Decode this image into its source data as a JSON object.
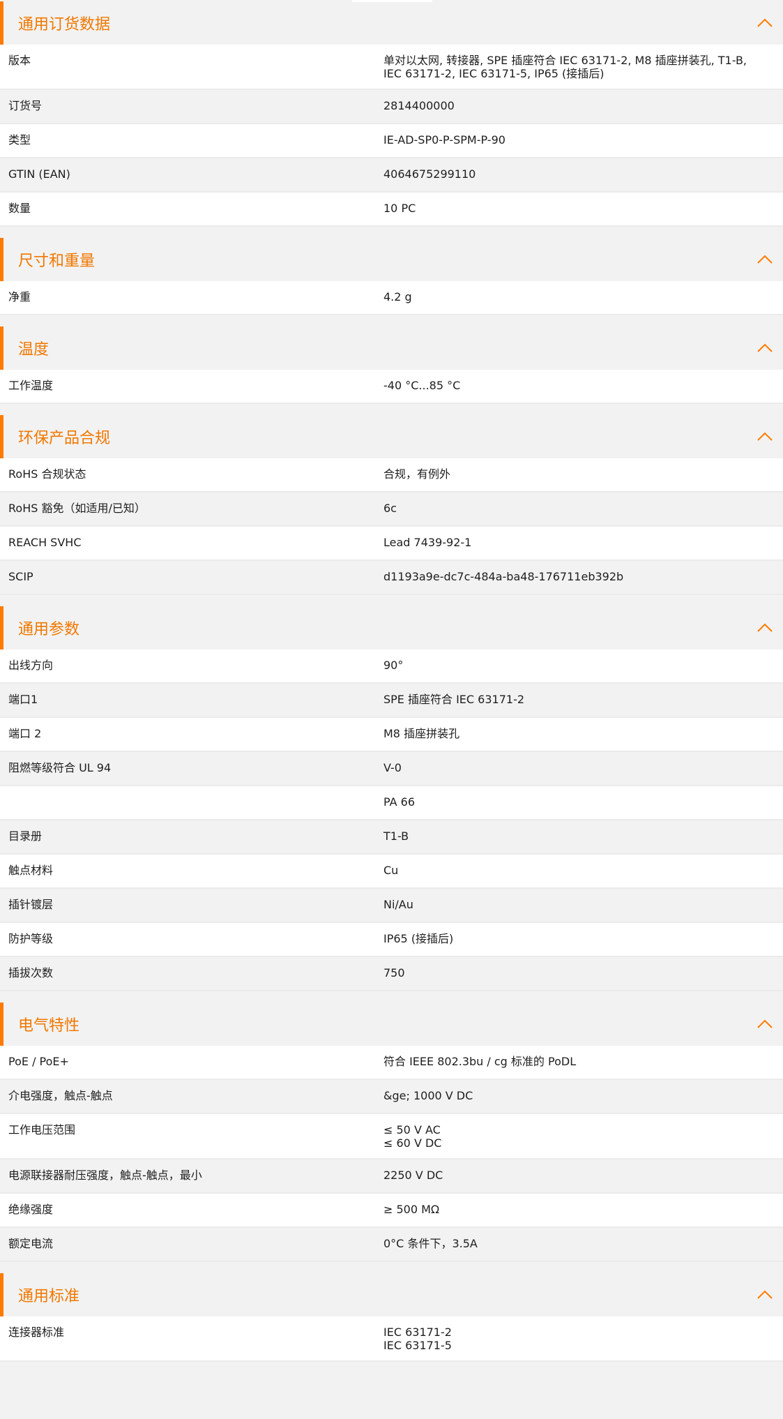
{
  "accent_color": "#ff7b00",
  "sections": [
    {
      "title": "通用订货数据",
      "collapse_icon": "chevron-up-icon",
      "rows": [
        {
          "label": "版本",
          "value": [
            "单对以太网, 转接器, SPE 插座符合 IEC 63171-2, M8 插座拼装孔, T1-B,",
            "IEC 63171-2, IEC 63171-5, IP65 (接插后)"
          ]
        },
        {
          "label": "订货号",
          "value": [
            "2814400000"
          ]
        },
        {
          "label": "类型",
          "value": [
            "IE-AD-SP0-P-SPM-P-90"
          ]
        },
        {
          "label": "GTIN (EAN)",
          "value": [
            "4064675299110"
          ]
        },
        {
          "label": "数量",
          "value": [
            "10  PC"
          ]
        }
      ]
    },
    {
      "title": "尺寸和重量",
      "collapse_icon": "chevron-up-icon",
      "rows": [
        {
          "label": "净重",
          "value": [
            "4.2  g"
          ]
        }
      ]
    },
    {
      "title": "温度",
      "collapse_icon": "chevron-up-icon",
      "rows": [
        {
          "label": "工作温度",
          "value": [
            "-40 °C...85 °C"
          ]
        }
      ]
    },
    {
      "title": "环保产品合规",
      "collapse_icon": "chevron-up-icon",
      "rows": [
        {
          "label": "RoHS 合规状态",
          "value": [
            "合规，有例外"
          ]
        },
        {
          "label": "RoHS 豁免（如适用/已知）",
          "value": [
            "6c"
          ]
        },
        {
          "label": "REACH SVHC",
          "value": [
            "Lead 7439-92-1"
          ]
        },
        {
          "label": "SCIP",
          "value": [
            "d1193a9e-dc7c-484a-ba48-176711eb392b"
          ]
        }
      ]
    },
    {
      "title": "通用参数",
      "collapse_icon": "chevron-up-icon",
      "rows": [
        {
          "label": "出线方向",
          "value": [
            "90°"
          ]
        },
        {
          "label": "端口1",
          "value": [
            "SPE 插座符合 IEC 63171-2"
          ]
        },
        {
          "label": "端口 2",
          "value": [
            "M8 插座拼装孔"
          ]
        },
        {
          "label": "阻燃等级符合 UL 94",
          "value": [
            "V-0"
          ]
        },
        {
          "label": "",
          "value": [
            "PA 66"
          ]
        },
        {
          "label": "目录册",
          "value": [
            "T1-B"
          ]
        },
        {
          "label": "触点材料",
          "value": [
            "Cu"
          ]
        },
        {
          "label": "插针镀层",
          "value": [
            "Ni/Au"
          ]
        },
        {
          "label": "防护等级",
          "value": [
            "IP65 (接插后)"
          ]
        },
        {
          "label": "插拔次数",
          "value": [
            "750"
          ]
        }
      ]
    },
    {
      "title": "电气特性",
      "collapse_icon": "chevron-up-icon",
      "rows": [
        {
          "label": "PoE / PoE+",
          "value": [
            "符合 IEEE 802.3bu / cg 标准的 PoDL"
          ]
        },
        {
          "label": "介电强度，触点-触点",
          "value": [
            "&ge; 1000 V DC"
          ]
        },
        {
          "label": "工作电压范围",
          "value": [
            "≤ 50 V AC",
            "≤ 60 V DC"
          ]
        },
        {
          "label": "电源联接器耐压强度，触点-触点，最小",
          "value": [
            "2250 V DC"
          ]
        },
        {
          "label": "绝缘强度",
          "value": [
            "≥ 500 MΩ"
          ]
        },
        {
          "label": "额定电流",
          "value": [
            "0°C 条件下，3.5A"
          ]
        }
      ]
    },
    {
      "title": "通用标准",
      "collapse_icon": "chevron-up-icon",
      "rows": [
        {
          "label": "连接器标准",
          "value": [
            "IEC 63171-2",
            "IEC 63171-5"
          ]
        }
      ]
    }
  ]
}
